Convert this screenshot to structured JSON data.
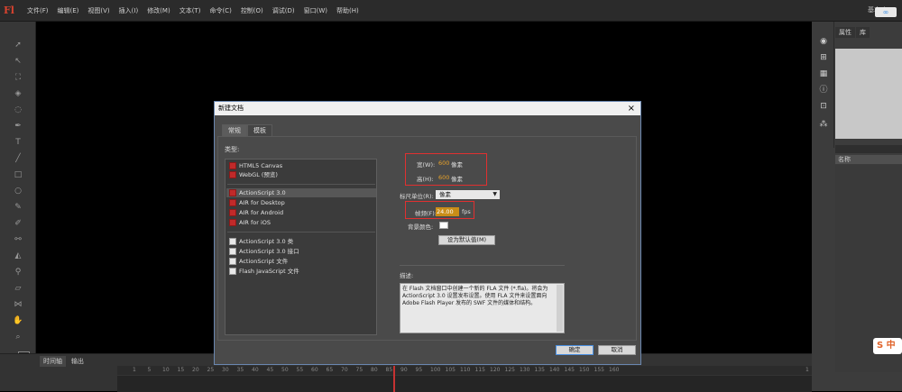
{
  "app": {
    "logo": "Fl"
  },
  "menu": [
    "文件(F)",
    "编辑(E)",
    "视图(V)",
    "插入(I)",
    "修改(M)",
    "文本(T)",
    "命令(C)",
    "控制(O)",
    "调试(D)",
    "窗口(W)",
    "帮助(H)"
  ],
  "workspace_label": "基本功",
  "cloud_badge": "∞",
  "ime_badge": "S 中",
  "right_panel": {
    "tabs": [
      "属性",
      "库"
    ],
    "search_placeholder": "",
    "column_header": "名称"
  },
  "timeline": {
    "tabs": [
      "时间轴",
      "输出"
    ],
    "ruler_labels": [
      "1",
      "5",
      "10",
      "15",
      "20",
      "25",
      "30",
      "35",
      "40",
      "45",
      "50",
      "55",
      "60",
      "65",
      "70",
      "75",
      "80",
      "85",
      "90",
      "95",
      "100",
      "105",
      "110",
      "115",
      "120",
      "125",
      "130",
      "135",
      "140",
      "145",
      "150",
      "155",
      "160",
      "1"
    ]
  },
  "dialog": {
    "title": "新建文档",
    "close": "×",
    "tabs": {
      "general": "常规",
      "templates": "模板"
    },
    "type_label": "类型:",
    "types": [
      {
        "label": "HTML5 Canvas",
        "group": 1,
        "icon": "red"
      },
      {
        "label": "WebGL (预览)",
        "group": 1,
        "icon": "red"
      },
      {
        "label": "ActionScript 3.0",
        "group": 2,
        "icon": "red",
        "selected": true
      },
      {
        "label": "AIR for Desktop",
        "group": 2,
        "icon": "red"
      },
      {
        "label": "AIR for Android",
        "group": 2,
        "icon": "red"
      },
      {
        "label": "AIR for iOS",
        "group": 2,
        "icon": "red"
      },
      {
        "label": "ActionScript 3.0 类",
        "group": 3,
        "icon": "white"
      },
      {
        "label": "ActionScript 3.0 接口",
        "group": 3,
        "icon": "white"
      },
      {
        "label": "ActionScript 文件",
        "group": 3,
        "icon": "white"
      },
      {
        "label": "Flash JavaScript 文件",
        "group": 3,
        "icon": "white"
      }
    ],
    "width_label": "宽(W):",
    "width_value": "600",
    "width_unit": "像素",
    "height_label": "高(H):",
    "height_value": "600",
    "height_unit": "像素",
    "ruler_units_label": "标尺单位(R):",
    "ruler_units_value": "像素",
    "fps_label": "帧频(F):",
    "fps_value": "24.00",
    "fps_unit": "fps",
    "bg_color_label": "背景颜色:",
    "bg_color": "#ffffff",
    "set_default_button": "设为默认值(M)",
    "description_label": "描述:",
    "description": "在 Flash 文档窗口中创建一个新的 FLA 文件 (*.fla)。将会为 ActionScript 3.0 设置发布设置。使用 FLA 文件来设置面向 Adobe Flash Player 发布的 SWF 文件的媒体和结构。",
    "ok_button": "确定",
    "cancel_button": "取消"
  },
  "colors": {
    "accent_highlight": "#c98d18",
    "annotation_red": "#e03030",
    "fill_color_swatch": "#c12a2a",
    "stroke_color_swatch": "#222222"
  }
}
